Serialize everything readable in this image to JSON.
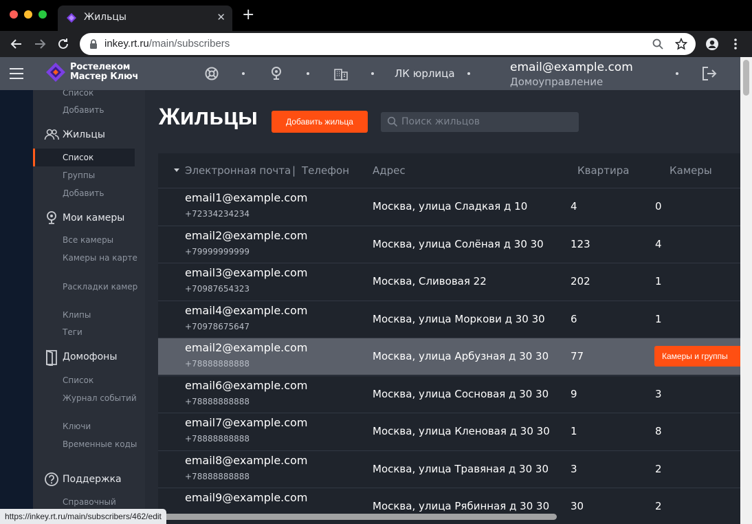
{
  "browser": {
    "tab_title": "Жильцы",
    "new_tab_symbol": "+",
    "tab_close_symbol": "✕",
    "url_host": "inkey.rt.ru",
    "url_path": "/main/subscribers",
    "status_url": "https://inkey.rt.ru/main/subscribers/462/edit"
  },
  "header": {
    "logo_line1": "Ростелеком",
    "logo_line2": "Мастер Ключ",
    "legal_link": "ЛК юрлица",
    "user_email": "email@example.com",
    "user_role": "Домоуправление"
  },
  "sidebar": {
    "top_items": [
      "Список",
      "Добавить"
    ],
    "sections": [
      {
        "label": "Жильцы",
        "icon": "users-icon",
        "items": [
          "Список",
          "Группы",
          "Добавить"
        ]
      },
      {
        "label": "Мои камеры",
        "icon": "camera-icon",
        "items": [
          "Все камеры",
          "Камеры на карте",
          "Раскладки камер",
          "Клипы",
          "Теги"
        ]
      },
      {
        "label": "Домофоны",
        "icon": "door-icon",
        "items": [
          "Список",
          "Журнал событий",
          "Ключи",
          "Временные коды"
        ]
      },
      {
        "label": "Поддержка",
        "icon": "help-icon",
        "items": [
          "Справочный"
        ]
      }
    ]
  },
  "main": {
    "title": "Жильцы",
    "add_button": "Добавить жильца",
    "search_placeholder": "Поиск жильцов"
  },
  "table": {
    "columns": {
      "email": "Электронная почта",
      "separator": "|",
      "phone": "Телефон",
      "address": "Адрес",
      "apartment": "Квартира",
      "cameras": "Камеры"
    },
    "row_action": "Камеры и группы",
    "rows": [
      {
        "email": "email1@example.com",
        "phone": "+72334234234",
        "address": "Москва, улица Сладкая  д 10",
        "apartment": "4",
        "cameras": "0"
      },
      {
        "email": "email2@example.com",
        "phone": "+79999999999",
        "address": "Москва, улица Солёная  д 30 30",
        "apartment": "123",
        "cameras": "4"
      },
      {
        "email": "email3@example.com",
        "phone": "+70987654323",
        "address": "Москва, Сливовая  22",
        "apartment": "202",
        "cameras": "1"
      },
      {
        "email": "email4@example.com",
        "phone": "+70978675647",
        "address": "Москва, улица Моркови  д 30 30",
        "apartment": "6",
        "cameras": "1"
      },
      {
        "email": "email2@example.com",
        "phone": "+78888888888",
        "address": "Москва, улица Арбузная д 30 30",
        "apartment": "77",
        "cameras": "",
        "selected": true
      },
      {
        "email": "email6@example.com",
        "phone": "+78888888888",
        "address": "Москва, улица Сосновая д 30 30",
        "apartment": "9",
        "cameras": "3"
      },
      {
        "email": "email7@example.com",
        "phone": "+78888888888",
        "address": "Москва, улица Кленовая д 30 30",
        "apartment": "1",
        "cameras": "8"
      },
      {
        "email": "email8@example.com",
        "phone": "+78888888888",
        "address": "Москва, улица Травяная  д 30 30",
        "apartment": "3",
        "cameras": "2"
      },
      {
        "email": "email9@example.com",
        "phone": "",
        "address": "Москва, улица Рябинная д 30 30",
        "apartment": "30",
        "cameras": "2"
      }
    ]
  }
}
